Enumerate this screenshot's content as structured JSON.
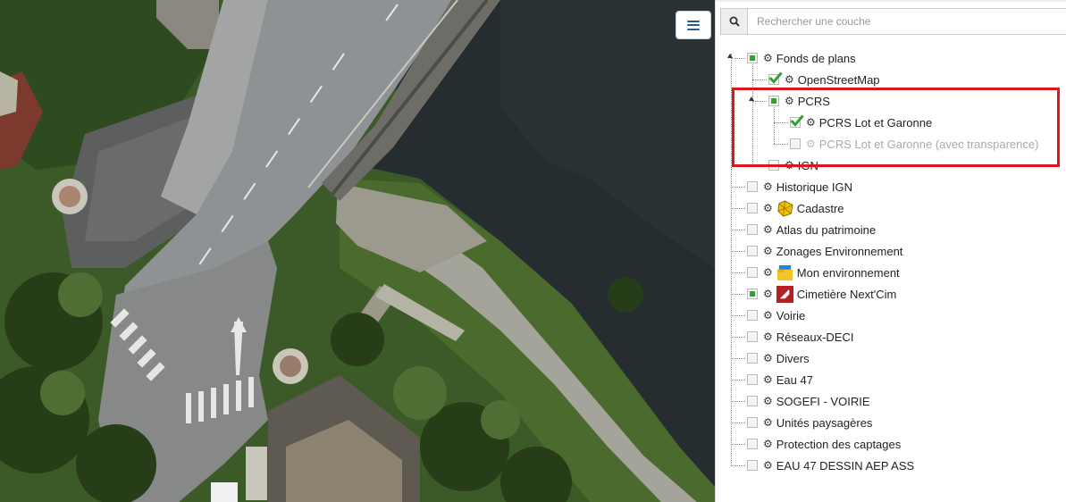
{
  "map": {
    "menu_button_icon": "hamburger-menu-icon",
    "colors": {
      "water": "#252d30",
      "road": "#8f9294",
      "vegetation": "#3c5a28",
      "bridge_rail": "#6d6c66"
    }
  },
  "panel": {
    "search": {
      "placeholder": "Rechercher une couche",
      "icon": "search-icon"
    },
    "layers": [
      {
        "label": "Fonds de plans",
        "state": "partial",
        "expanded": true
      },
      {
        "label": "OpenStreetMap",
        "state": "checked"
      },
      {
        "label": "PCRS",
        "state": "partial",
        "expanded": true
      },
      {
        "label": "PCRS Lot et Garonne",
        "state": "checked"
      },
      {
        "label": "PCRS Lot et Garonne (avec transparence)",
        "state": "unchecked",
        "disabled": true
      },
      {
        "label": "IGN",
        "state": "unchecked"
      },
      {
        "label": "Historique IGN",
        "state": "unchecked"
      },
      {
        "label": "Cadastre",
        "state": "unchecked",
        "icon": "cadastre-icon"
      },
      {
        "label": "Atlas du patrimoine",
        "state": "unchecked"
      },
      {
        "label": "Zonages Environnement",
        "state": "unchecked"
      },
      {
        "label": "Mon environnement",
        "state": "unchecked",
        "icon": "environment-folder-icon"
      },
      {
        "label": "Cimetière Next'Cim",
        "state": "partial",
        "icon": "cemetery-icon"
      },
      {
        "label": "Voirie",
        "state": "unchecked"
      },
      {
        "label": "Réseaux-DECI",
        "state": "unchecked"
      },
      {
        "label": "Divers",
        "state": "unchecked"
      },
      {
        "label": "Eau 47",
        "state": "unchecked"
      },
      {
        "label": "SOGEFI - VOIRIE",
        "state": "unchecked"
      },
      {
        "label": "Unités paysagères",
        "state": "unchecked"
      },
      {
        "label": "Protection des captages",
        "state": "unchecked"
      },
      {
        "label": "EAU 47 DESSIN AEP ASS",
        "state": "unchecked"
      }
    ],
    "highlight_color": "#e0141c",
    "check_color": "#2ea32e",
    "gear_icon": "gear-icon"
  }
}
